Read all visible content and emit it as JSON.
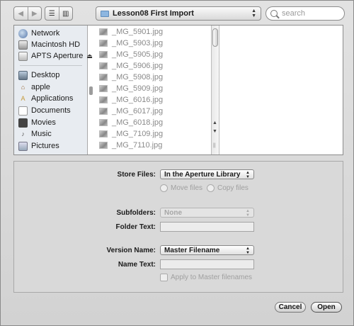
{
  "toolbar": {
    "back_glyph": "◀",
    "forward_glyph": "▶",
    "list_view_glyph": "☰",
    "column_view_glyph": "▥",
    "path_label": "Lesson08 First Import",
    "search_placeholder": "search"
  },
  "sidebar": {
    "devices": [
      {
        "label": "Network",
        "icon": "network-icon"
      },
      {
        "label": "Macintosh HD",
        "icon": "hard-drive-icon"
      },
      {
        "label": "APTS Aperture",
        "icon": "external-drive-icon",
        "eject": "⏏"
      }
    ],
    "places": [
      {
        "label": "Desktop",
        "icon": "desktop-icon"
      },
      {
        "label": "apple",
        "icon": "home-icon",
        "glyph": "⌂"
      },
      {
        "label": "Applications",
        "icon": "applications-icon",
        "glyph": "A"
      },
      {
        "label": "Documents",
        "icon": "documents-icon"
      },
      {
        "label": "Movies",
        "icon": "movies-icon"
      },
      {
        "label": "Music",
        "icon": "music-icon",
        "glyph": "♪"
      },
      {
        "label": "Pictures",
        "icon": "pictures-icon"
      }
    ]
  },
  "files": [
    "_MG_5901.jpg",
    "_MG_5903.jpg",
    "_MG_5905.jpg",
    "_MG_5906.jpg",
    "_MG_5908.jpg",
    "_MG_5909.jpg",
    "_MG_6016.jpg",
    "_MG_6017.jpg",
    "_MG_6018.jpg",
    "_MG_7109.jpg",
    "_MG_7110.jpg"
  ],
  "options": {
    "store_files_label": "Store Files:",
    "store_files_value": "In the Aperture Library",
    "move_files_label": "Move files",
    "copy_files_label": "Copy files",
    "subfolders_label": "Subfolders:",
    "subfolders_value": "None",
    "folder_text_label": "Folder Text:",
    "version_name_label": "Version Name:",
    "version_name_value": "Master Filename",
    "name_text_label": "Name Text:",
    "apply_label": "Apply to Master filenames"
  },
  "buttons": {
    "cancel": "Cancel",
    "open": "Open"
  }
}
